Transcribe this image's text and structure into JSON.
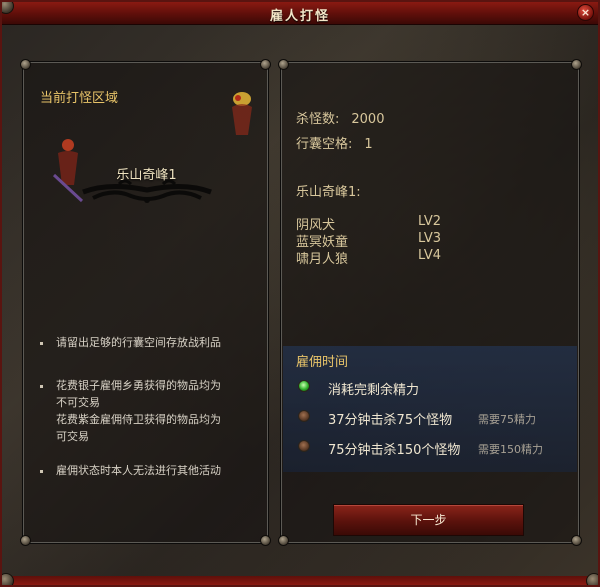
{
  "window": {
    "title": "雇人打怪",
    "close_label": "×"
  },
  "left_panel": {
    "heading": "当前打怪区域",
    "zone_name": "乐山奇峰1",
    "notes": [
      {
        "lines": [
          "请留出足够的行囊空间存放战利品"
        ]
      },
      {
        "lines": [
          "花费银子雇佣乡勇获得的物品均为",
          "不可交易",
          "花费紫金雇佣侍卫获得的物品均为",
          "可交易"
        ]
      },
      {
        "lines": [
          "雇佣状态时本人无法进行其他活动"
        ]
      }
    ]
  },
  "right_panel": {
    "kill_count_label": "杀怪数:",
    "kill_count_value": "2000",
    "bag_space_label": "行囊空格:",
    "bag_space_value": "1",
    "zone_label": "乐山奇峰1:",
    "monsters": [
      {
        "name": "阴风犬",
        "level": "LV2"
      },
      {
        "name": "蓝冥妖童",
        "level": "LV3"
      },
      {
        "name": "啸月人狼",
        "level": "LV4"
      }
    ],
    "hire_time_title": "雇佣时间",
    "options": [
      {
        "label": "消耗完剩余精力",
        "requirement": "",
        "selected": true
      },
      {
        "label": "37分钟击杀75个怪物",
        "requirement": "需要75精力",
        "selected": false
      },
      {
        "label": "75分钟击杀150个怪物",
        "requirement": "需要150精力",
        "selected": false
      }
    ]
  },
  "next_button": {
    "label": "下一步"
  },
  "colors": {
    "accent_gold": "#e8c469",
    "frame_red": "#8a1a12",
    "radio_selected": "#2fae2a"
  }
}
